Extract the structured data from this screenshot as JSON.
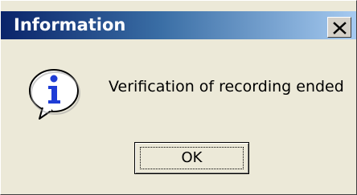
{
  "dialog": {
    "title": "Information",
    "message": "Verification of recording ended",
    "ok_label": "OK",
    "icon": "info-icon",
    "close_icon": "close-icon"
  },
  "colors": {
    "titlebar_start": "#0a246a",
    "titlebar_end": "#a6caf0",
    "dialog_bg": "#ece9d8",
    "icon_blue": "#1f3dd6"
  }
}
